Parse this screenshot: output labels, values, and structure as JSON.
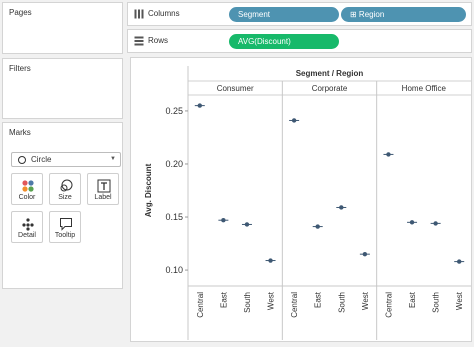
{
  "pages": {
    "title": "Pages"
  },
  "filters": {
    "title": "Filters"
  },
  "marks": {
    "title": "Marks",
    "mark_type": "Circle",
    "buttons": [
      {
        "label": "Color",
        "icon": "color-icon"
      },
      {
        "label": "Size",
        "icon": "size-icon"
      },
      {
        "label": "Label",
        "icon": "label-icon"
      },
      {
        "label": "Detail",
        "icon": "detail-icon"
      },
      {
        "label": "Tooltip",
        "icon": "tooltip-icon"
      }
    ]
  },
  "shelves": {
    "columns": {
      "label": "Columns",
      "pills": [
        "Segment",
        "⊞ Region"
      ]
    },
    "rows": {
      "label": "Rows",
      "pills": [
        "AVG(Discount)"
      ]
    }
  },
  "colors": {
    "dimension_pill": "#4e93b1",
    "measure_pill": "#17b96a",
    "mark": "#3e5873"
  },
  "chart_data": {
    "type": "scatter",
    "title": "Segment / Region",
    "ylabel": "Avg. Discount",
    "ylim": [
      0.085,
      0.265
    ],
    "yticks": [
      0.1,
      0.15,
      0.2,
      0.25
    ],
    "ytick_labels": [
      "0.10",
      "0.15",
      "0.20",
      "0.25"
    ],
    "groups": [
      "Consumer",
      "Corporate",
      "Home Office"
    ],
    "categories": [
      "Central",
      "East",
      "South",
      "West"
    ],
    "series": [
      {
        "group": "Consumer",
        "values": [
          0.255,
          0.147,
          0.143,
          0.109
        ]
      },
      {
        "group": "Corporate",
        "values": [
          0.241,
          0.141,
          0.159,
          0.115
        ]
      },
      {
        "group": "Home Office",
        "values": [
          0.209,
          0.145,
          0.144,
          0.108
        ]
      }
    ],
    "grid": false
  }
}
